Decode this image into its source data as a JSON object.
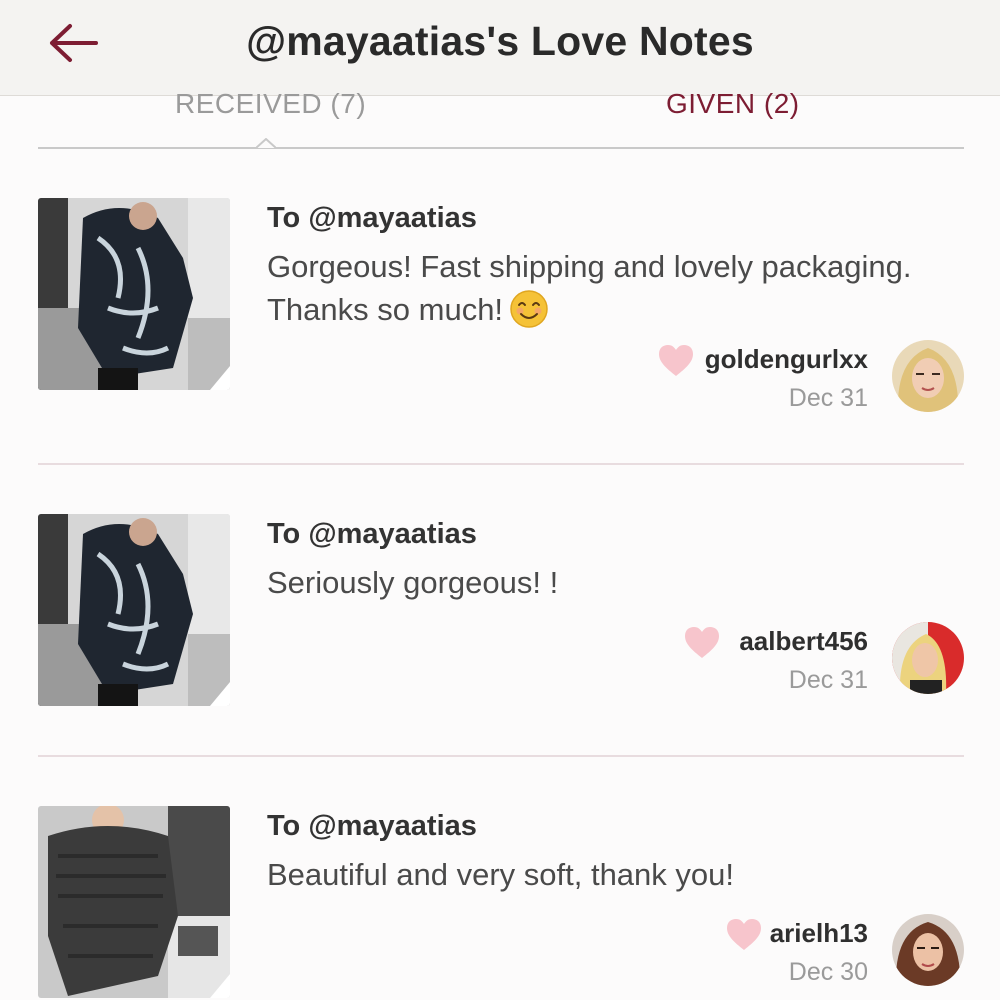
{
  "header": {
    "title": "@mayaatias's Love Notes",
    "back_icon": "arrow-left-icon",
    "accent_color": "#7d1d33"
  },
  "tabs": [
    {
      "label": "RECEIVED (7)",
      "active": true
    },
    {
      "label": "GIVEN (2)",
      "active": false
    }
  ],
  "notes": [
    {
      "to": "To @mayaatias",
      "message": "Gorgeous! Fast shipping and lovely packaging. Thanks so much!",
      "emoji": "smiling-face-icon",
      "username": "goldengurlxx",
      "date": "Dec 31"
    },
    {
      "to": "To @mayaatias",
      "message": "Seriously gorgeous! !",
      "username": "aalbert456",
      "date": "Dec 31"
    },
    {
      "to": "To @mayaatias",
      "message": "Beautiful and very soft, thank you!",
      "username": "arielh13",
      "date": "Dec 30"
    }
  ],
  "colors": {
    "heart": "#f7c5cc",
    "divider": "#e8dcdf",
    "given_tab": "#7d1d33",
    "received_tab": "#9a9a9a"
  }
}
